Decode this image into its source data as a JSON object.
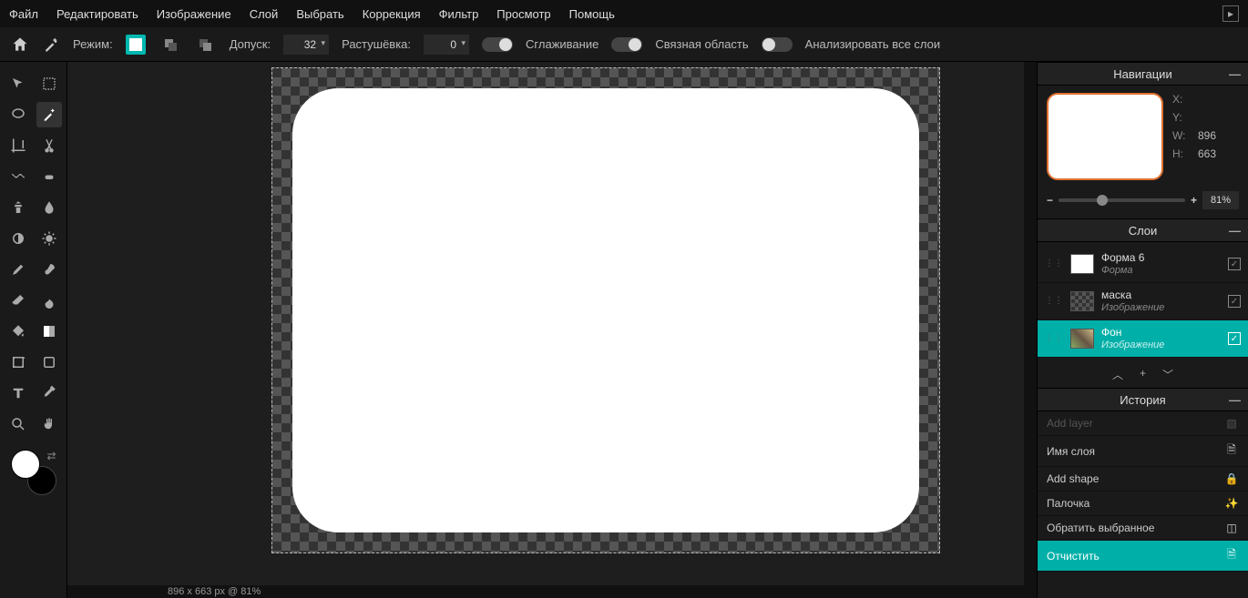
{
  "menu": [
    "Файл",
    "Редактировать",
    "Изображение",
    "Слой",
    "Выбрать",
    "Коррекция",
    "Фильтр",
    "Просмотр",
    "Помощь"
  ],
  "options": {
    "mode_label": "Режим:",
    "tolerance_label": "Допуск:",
    "tolerance_value": "32",
    "feather_label": "Растушёвка:",
    "feather_value": "0",
    "antialias_label": "Сглаживание",
    "contiguous_label": "Связная область",
    "all_layers_label": "Анализировать все слои"
  },
  "nav": {
    "title": "Навигации",
    "x_label": "X:",
    "y_label": "Y:",
    "w_label": "W:",
    "w_val": "896",
    "h_label": "H:",
    "h_val": "663",
    "zoom": "81%"
  },
  "layers": {
    "title": "Слои",
    "items": [
      {
        "name": "Форма 6",
        "type": "Форма",
        "thumb": "white",
        "selected": false
      },
      {
        "name": "маска",
        "type": "Изображение",
        "thumb": "checker",
        "selected": false
      },
      {
        "name": "Фон",
        "type": "Изображение",
        "thumb": "img",
        "selected": true
      }
    ]
  },
  "history": {
    "title": "История",
    "items": [
      {
        "label": "Add layer",
        "selected": false,
        "dim": true,
        "icon": "layer"
      },
      {
        "label": "Имя слоя",
        "selected": false,
        "icon": "text"
      },
      {
        "label": "Add shape",
        "selected": false,
        "icon": "lock"
      },
      {
        "label": "Палочка",
        "selected": false,
        "icon": "wand"
      },
      {
        "label": "Обратить выбранное",
        "selected": false,
        "icon": "sel"
      },
      {
        "label": "Отчистить",
        "selected": true,
        "icon": "clear"
      }
    ]
  },
  "status": "896 x 663 px @ 81%"
}
